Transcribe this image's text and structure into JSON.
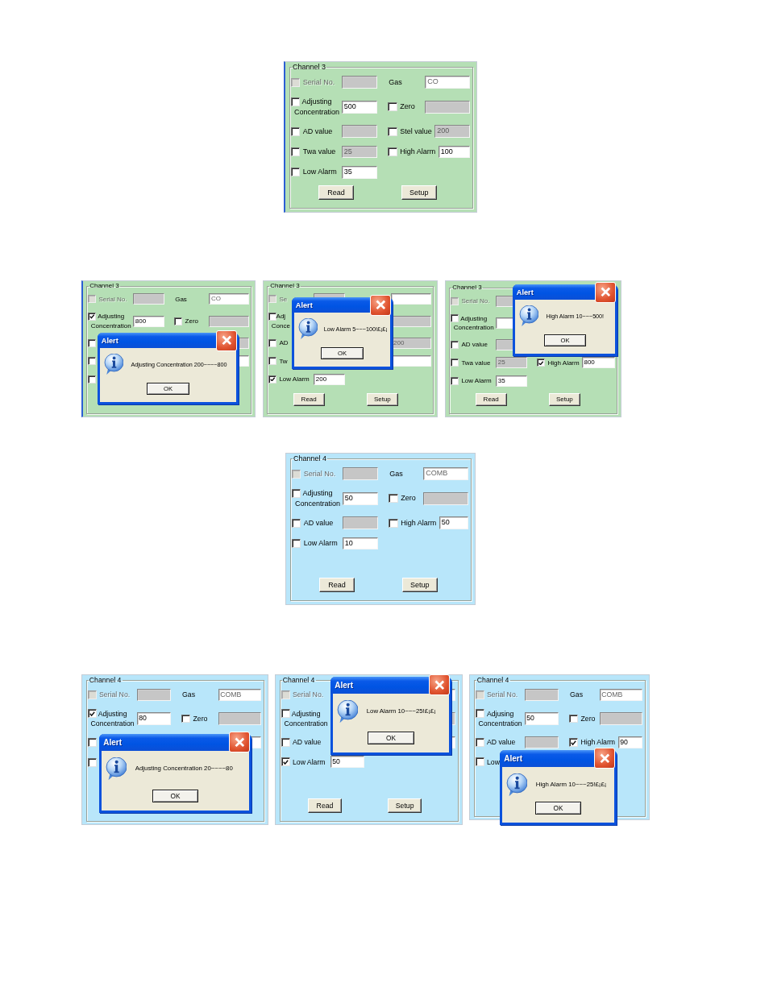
{
  "figures": [
    {
      "panels": [
        {
          "color": "#b5dfb5",
          "group_title": "Channel 3",
          "rows": [
            {
              "left": {
                "kind": "check",
                "label": "Serial No.",
                "checked": false,
                "disabled": true
              },
              "left_field": {
                "kind": "disabled"
              },
              "right": {
                "kind": "text",
                "label": "Gas"
              },
              "right_field": {
                "kind": "readonly",
                "value": "CO"
              }
            },
            {
              "left": {
                "kind": "check",
                "label": "Adjusting\nConcentration",
                "checked": false,
                "disabled": false
              },
              "left_field": {
                "kind": "editable",
                "value": "500"
              },
              "right": {
                "kind": "check",
                "label": "Zero",
                "checked": false,
                "disabled": false
              },
              "right_field": {
                "kind": "disabled"
              }
            },
            {
              "left": {
                "kind": "check",
                "label": "AD value",
                "checked": false,
                "disabled": false
              },
              "left_field": {
                "kind": "disabled"
              },
              "right": {
                "kind": "check",
                "label": "Stel value",
                "checked": false,
                "disabled": false
              },
              "right_field": {
                "kind": "disabled",
                "value": "200"
              }
            },
            {
              "left": {
                "kind": "check",
                "label": "Twa value",
                "checked": false,
                "disabled": false
              },
              "left_field": {
                "kind": "disabled",
                "value": "25"
              },
              "right": {
                "kind": "check",
                "label": "High Alarm",
                "checked": false,
                "disabled": false
              },
              "right_field": {
                "kind": "editable",
                "value": "100"
              }
            },
            {
              "left": {
                "kind": "check",
                "label": "Low Alarm",
                "checked": false,
                "disabled": false
              },
              "left_field": {
                "kind": "editable",
                "value": "35"
              }
            }
          ],
          "buttons": [
            "Read",
            "Setup"
          ]
        }
      ]
    },
    {
      "panels": [
        {
          "color": "#b5dfb5",
          "group_title": "Channel 3",
          "rows": [
            {
              "left": {
                "kind": "check",
                "label": "Serial No.",
                "checked": false,
                "disabled": true
              },
              "left_field": {
                "kind": "disabled"
              },
              "right": {
                "kind": "text",
                "label": "Gas"
              },
              "right_field": {
                "kind": "readonly",
                "value": "CO"
              }
            },
            {
              "left": {
                "kind": "check",
                "label": "Adjusting\nConcentration",
                "checked": true,
                "disabled": false
              },
              "left_field": {
                "kind": "editable",
                "value": "800"
              },
              "right": {
                "kind": "check",
                "label": "Zero",
                "checked": false,
                "disabled": false
              },
              "right_field": {
                "kind": "disabled"
              }
            },
            {
              "left": {
                "kind": "check",
                "checked": false,
                "disabled": false
              },
              "right_field": {
                "kind": "disabled"
              }
            },
            {
              "left": {
                "kind": "check",
                "checked": false,
                "disabled": false
              },
              "right_field": {
                "kind": "editable"
              }
            },
            {
              "left": {
                "kind": "check",
                "checked": false,
                "disabled": false
              }
            }
          ],
          "alert": {
            "title": "Alert",
            "message": "Adjusting Concentration 200~~~~800",
            "button": "OK"
          }
        },
        {
          "color": "#b5dfb5",
          "group_title": "Channel 3",
          "rows": [
            {
              "left": {
                "kind": "check",
                "label": "Se",
                "checked": false,
                "disabled": true
              },
              "left_field": {
                "kind": "disabled"
              },
              "right_field": {
                "kind": "readonly"
              }
            },
            {
              "left": {
                "kind": "check",
                "label": "Adj\nConce",
                "checked": false,
                "disabled": false
              },
              "right_field": {
                "kind": "disabled"
              }
            },
            {
              "left": {
                "kind": "check",
                "label": "AD",
                "checked": false,
                "disabled": false
              },
              "right_field": {
                "kind": "disabled",
                "value": "200"
              }
            },
            {
              "left": {
                "kind": "check",
                "label": "Tw",
                "checked": false,
                "disabled": false
              },
              "right_field": {
                "kind": "editable"
              }
            },
            {
              "left": {
                "kind": "check",
                "label": "Low Alarm",
                "checked": true,
                "disabled": false
              },
              "left_field": {
                "kind": "editable",
                "value": "200"
              }
            }
          ],
          "buttons": [
            "Read",
            "Setup"
          ],
          "alert": {
            "title": "Alert",
            "message": "Low Alarm 5~~~100!£¡£¡",
            "button": "OK"
          }
        },
        {
          "color": "#b5dfb5",
          "group_title": "Channel 3",
          "rows": [
            {
              "left": {
                "kind": "check",
                "label": "Serial No.",
                "checked": false,
                "disabled": true
              },
              "left_field": {
                "kind": "disabled"
              }
            },
            {
              "left": {
                "kind": "check",
                "label": "Adjusting\nConcentration",
                "checked": false,
                "disabled": false
              },
              "left_field": {
                "kind": "editable"
              }
            },
            {
              "left": {
                "kind": "check",
                "label": "AD value",
                "checked": false,
                "disabled": false
              },
              "left_field": {
                "kind": "disabled"
              }
            },
            {
              "left": {
                "kind": "check",
                "label": "Twa value",
                "checked": false,
                "disabled": false
              },
              "left_field": {
                "kind": "disabled",
                "value": "25"
              },
              "right": {
                "kind": "check",
                "label": "High Alarm",
                "checked": true,
                "disabled": false
              },
              "right_field": {
                "kind": "editable",
                "value": "800"
              }
            },
            {
              "left": {
                "kind": "check",
                "label": "Low Alarm",
                "checked": false,
                "disabled": false
              },
              "left_field": {
                "kind": "editable",
                "value": "35"
              }
            }
          ],
          "buttons": [
            "Read",
            "Setup"
          ],
          "alert": {
            "title": "Alert",
            "message": "High Alarm 10~~~500!",
            "button": "OK"
          }
        }
      ]
    },
    {
      "panels": [
        {
          "color": "#b8e6fa",
          "group_title": "Channel 4",
          "rows": [
            {
              "left": {
                "kind": "check",
                "label": "Serial No.",
                "checked": false,
                "disabled": true
              },
              "left_field": {
                "kind": "disabled"
              },
              "right": {
                "kind": "text",
                "label": "Gas"
              },
              "right_field": {
                "kind": "readonly",
                "value": "COMB"
              }
            },
            {
              "left": {
                "kind": "check",
                "label": "Adjusting\nConcentration",
                "checked": false,
                "disabled": false
              },
              "left_field": {
                "kind": "editable",
                "value": "50"
              },
              "right": {
                "kind": "check",
                "label": "Zero",
                "checked": false,
                "disabled": false
              },
              "right_field": {
                "kind": "disabled"
              }
            },
            {
              "left": {
                "kind": "check",
                "label": "AD value",
                "checked": false,
                "disabled": false
              },
              "left_field": {
                "kind": "disabled"
              },
              "right": {
                "kind": "check",
                "label": "High Alarm",
                "checked": false,
                "disabled": false
              },
              "right_field": {
                "kind": "editable",
                "value": "50"
              }
            },
            {
              "left": {
                "kind": "check",
                "label": "Low Alarm",
                "checked": false,
                "disabled": false
              },
              "left_field": {
                "kind": "editable",
                "value": "10"
              }
            }
          ],
          "buttons": [
            "Read",
            "Setup"
          ]
        }
      ]
    },
    {
      "panels": [
        {
          "color": "#b8e6fa",
          "group_title": "Channel 4",
          "rows": [
            {
              "left": {
                "kind": "check",
                "label": "Serial No.",
                "checked": false,
                "disabled": true
              },
              "left_field": {
                "kind": "disabled"
              },
              "right": {
                "kind": "text",
                "label": "Gas"
              },
              "right_field": {
                "kind": "readonly",
                "value": "COMB"
              }
            },
            {
              "left": {
                "kind": "check",
                "label": "Adjusting\nConcentration",
                "checked": true,
                "disabled": false
              },
              "left_field": {
                "kind": "editable",
                "value": "80"
              },
              "right": {
                "kind": "check",
                "label": "Zero",
                "checked": false,
                "disabled": false
              },
              "right_field": {
                "kind": "disabled"
              }
            },
            {
              "left": {
                "kind": "check",
                "checked": false,
                "disabled": false
              },
              "right_field": {
                "kind": "editable"
              }
            },
            {
              "left": {
                "kind": "check",
                "checked": false,
                "disabled": false
              }
            }
          ],
          "alert": {
            "title": "Alert",
            "message": "Adjusting Concentration 20~~~~80",
            "button": "OK"
          }
        },
        {
          "color": "#b8e6fa",
          "group_title": "Channel 4",
          "rows": [
            {
              "left": {
                "kind": "check",
                "label": "Serial No.",
                "checked": false,
                "disabled": true
              },
              "right_field": {
                "kind": "readonly"
              }
            },
            {
              "left": {
                "kind": "check",
                "label": "Adjusting\nConcentration",
                "checked": false,
                "disabled": false
              },
              "right_field": {
                "kind": "disabled"
              }
            },
            {
              "left": {
                "kind": "check",
                "label": "AD value",
                "checked": false,
                "disabled": false
              },
              "right_field": {
                "kind": "editable"
              }
            },
            {
              "left": {
                "kind": "check",
                "label": "Low Alarm",
                "checked": true,
                "disabled": false
              },
              "left_field": {
                "kind": "editable",
                "value": "50"
              }
            }
          ],
          "buttons": [
            "Read",
            "Setup"
          ],
          "alert": {
            "title": "Alert",
            "message": "Low Alarm 10~~~25!£¡£¡",
            "button": "OK"
          }
        },
        {
          "color": "#b8e6fa",
          "group_title": "Channel 4",
          "rows": [
            {
              "left": {
                "kind": "check",
                "label": "Serial No.",
                "checked": false,
                "disabled": true
              },
              "left_field": {
                "kind": "disabled"
              },
              "right": {
                "kind": "text",
                "label": "Gas"
              },
              "right_field": {
                "kind": "readonly",
                "value": "COMB"
              }
            },
            {
              "left": {
                "kind": "check",
                "label": "Adjusing\nConcentration",
                "checked": false,
                "disabled": false
              },
              "left_field": {
                "kind": "editable",
                "value": "50"
              },
              "right": {
                "kind": "check",
                "label": "Zero",
                "checked": false,
                "disabled": false
              },
              "right_field": {
                "kind": "disabled"
              }
            },
            {
              "left": {
                "kind": "check",
                "label": "AD value",
                "checked": false,
                "disabled": false
              },
              "left_field": {
                "kind": "disabled"
              },
              "right": {
                "kind": "check",
                "label": "High Alarm",
                "checked": true,
                "disabled": false
              },
              "right_field": {
                "kind": "editable",
                "value": "90"
              }
            },
            {
              "left": {
                "kind": "check",
                "label": "Low",
                "checked": false,
                "disabled": false
              }
            }
          ],
          "alert": {
            "title": "Alert",
            "message": "High Alarm 10~~~25!£¡£¡",
            "button": "OK"
          }
        }
      ]
    }
  ]
}
